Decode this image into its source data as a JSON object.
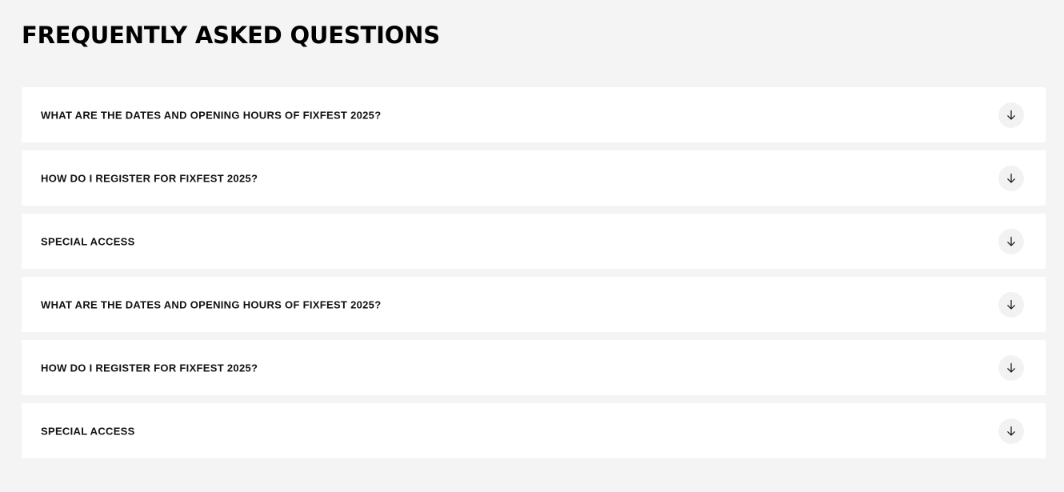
{
  "faq": {
    "title": "FREQUENTLY ASKED QUESTIONS",
    "toggle_icon": "arrow-down-icon",
    "items": [
      {
        "question": "WHAT ARE THE DATES AND OPENING HOURS OF FIXFEST 2025?"
      },
      {
        "question": "HOW DO I REGISTER FOR FIXFEST 2025?"
      },
      {
        "question": "SPECIAL ACCESS"
      },
      {
        "question": "WHAT ARE THE DATES AND OPENING HOURS OF FIXFEST 2025?"
      },
      {
        "question": "HOW DO I REGISTER FOR FIXFEST 2025?"
      },
      {
        "question": "SPECIAL ACCESS"
      }
    ]
  },
  "colors": {
    "page_background": "#f4f4f4",
    "card_background": "#ffffff",
    "toggle_background": "#f2f2f2",
    "text": "#000000"
  }
}
